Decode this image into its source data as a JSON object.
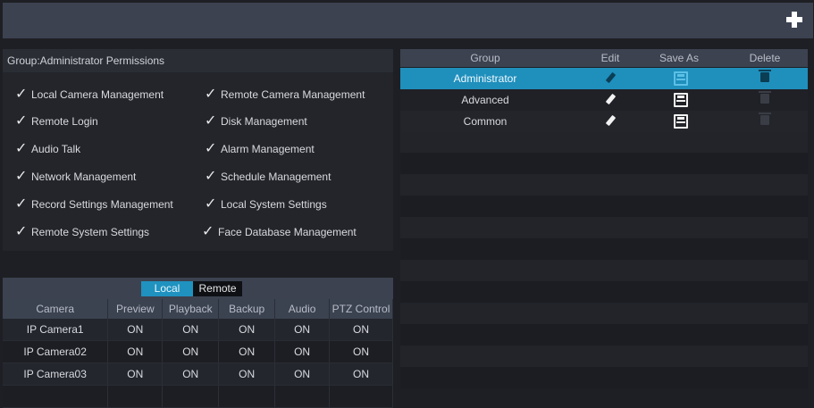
{
  "toolbar": {
    "add_icon": "plus-icon"
  },
  "permissions": {
    "header": "Group:Administrator Permissions",
    "left": [
      "Local Camera Management",
      "Remote Login",
      "Audio Talk",
      "Network Management",
      "Record Settings Management",
      "Remote System Settings"
    ],
    "right": [
      "Remote Camera Management",
      "Disk Management",
      "Alarm Management",
      "Schedule Management",
      "Local System Settings",
      "Face Database Management"
    ],
    "check_icon": "✓"
  },
  "camera_tabs": {
    "local": "Local",
    "remote": "Remote",
    "active": "Local"
  },
  "camera_table": {
    "headers": [
      "Camera",
      "Preview",
      "Playback",
      "Backup",
      "Audio",
      "PTZ Control"
    ],
    "rows": [
      [
        "IP Camera1",
        "ON",
        "ON",
        "ON",
        "ON",
        "ON"
      ],
      [
        "IP Camera02",
        "ON",
        "ON",
        "ON",
        "ON",
        "ON"
      ],
      [
        "IP Camera03",
        "ON",
        "ON",
        "ON",
        "ON",
        "ON"
      ]
    ]
  },
  "groups": {
    "headers": {
      "group": "Group",
      "edit": "Edit",
      "save_as": "Save As",
      "delete": "Delete"
    },
    "rows": [
      {
        "name": "Administrator",
        "selected": true
      },
      {
        "name": "Advanced",
        "selected": false
      },
      {
        "name": "Common",
        "selected": false
      }
    ]
  },
  "colors": {
    "accent": "#1f8fbc",
    "header": "#3c4250",
    "background": "#1e1f24"
  }
}
